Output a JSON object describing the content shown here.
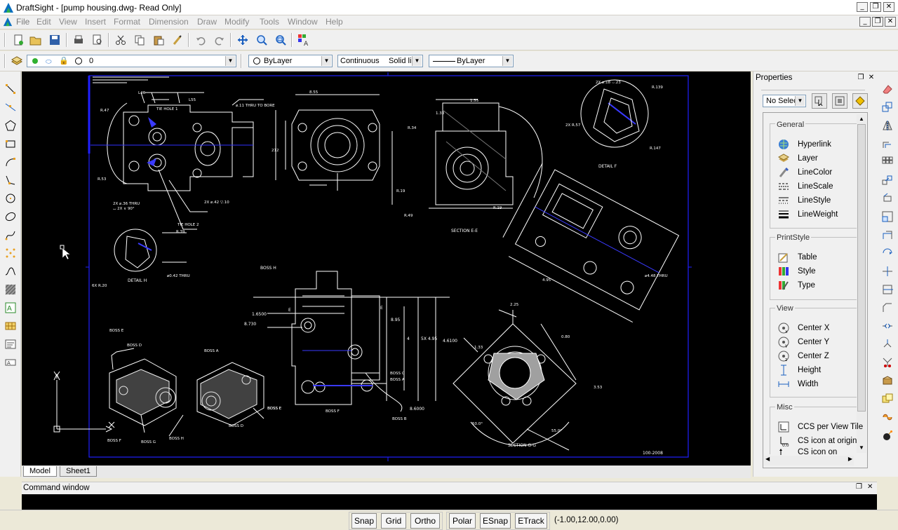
{
  "window": {
    "title": "DraftSight - [pump housing.dwg- Read Only]"
  },
  "menu": [
    "File",
    "Edit",
    "View",
    "Insert",
    "Format",
    "Dimension",
    "Draw",
    "Modify",
    "Tools",
    "Window",
    "Help"
  ],
  "layer_toolbar": {
    "layer_value": "0"
  },
  "properties_toolbar": {
    "color_value": "ByLayer",
    "linetype_value": "Continuous",
    "linetype_desc": "Solid li",
    "lineweight_value": "ByLayer"
  },
  "properties_panel": {
    "title": "Properties",
    "selection_value": "No Selec",
    "general": {
      "title": "General",
      "items": [
        "Hyperlink",
        "Layer",
        "LineColor",
        "LineScale",
        "LineStyle",
        "LineWeight"
      ]
    },
    "printstyle": {
      "title": "PrintStyle",
      "items": [
        "Table",
        "Style",
        "Type"
      ]
    },
    "view": {
      "title": "View",
      "items": [
        "Center X",
        "Center Y",
        "Center Z",
        "Height",
        "Width"
      ]
    },
    "misc": {
      "title": "Misc",
      "items": [
        "CCS per View Tile",
        "CS icon at origin",
        "CS icon on"
      ]
    }
  },
  "drawing": {
    "labels": {
      "detail_f": "DETAIL F",
      "detail_h": "DETAIL H",
      "section_e": "SECTION E-E",
      "section_g": "SECTION G-G",
      "boss_h": "BOSS H",
      "boss_a": "BOSS A",
      "boss_b": "BOSS B",
      "boss_c": "BOSS C",
      "boss_d": "BOSS D",
      "boss_e": "BOSS E",
      "boss_f": "BOSS F",
      "boss_g": "BOSS G",
      "tie_hole_1": "TIE HOLE 1",
      "tie_hole_2": "TIE HOLE 2",
      "thru_to_bore": "⌀.11 THRU TO BORE",
      "drawing_number": "100-2008"
    },
    "dims": {
      "d_855": "8.55",
      "d_155": "1.55",
      "d_133": "1.33",
      "d_16": "1.6",
      "d_r34": "R.34",
      "d_r19": "R.19",
      "d_r49": "R.49",
      "d_r39": "R.39",
      "d_6500": "1.6500",
      "d_8730": "8.730",
      "d_895": "8.95",
      "d_4": "4",
      "d_495": "5X 4.95",
      "d_4610": "4.6100",
      "d_6000": "8.6000",
      "d_353": "3.53",
      "d_133b": "1.33"
    }
  },
  "tabs": {
    "model": "Model",
    "sheet1": "Sheet1"
  },
  "command_window": {
    "title": "Command window"
  },
  "status": {
    "buttons": [
      "Snap",
      "Grid",
      "Ortho",
      "Polar",
      "ESnap",
      "ETrack"
    ],
    "coords": "(-1.00,12.00,0.00)"
  }
}
